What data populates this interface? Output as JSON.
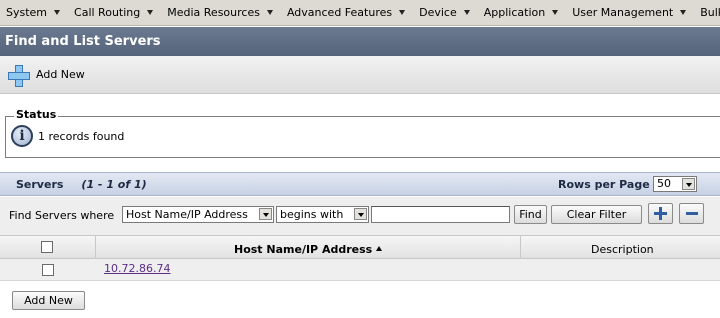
{
  "menu": {
    "items": [
      {
        "label": "System"
      },
      {
        "label": "Call Routing"
      },
      {
        "label": "Media Resources"
      },
      {
        "label": "Advanced Features"
      },
      {
        "label": "Device"
      },
      {
        "label": "Application"
      },
      {
        "label": "User Management"
      },
      {
        "label": "Bulk Administration"
      }
    ]
  },
  "page": {
    "title": "Find and List Servers"
  },
  "toolbar": {
    "add_new_label": "Add New",
    "add_icon": "add-plus-icon"
  },
  "status": {
    "legend": "Status",
    "icon": "info-icon",
    "icon_glyph": "i",
    "message": "1 records found"
  },
  "servers": {
    "title": "Servers",
    "count": "(1 - 1 of 1)",
    "rows_per_page_label": "Rows per Page",
    "rows_per_page_value": "50"
  },
  "filter": {
    "label": "Find Servers where",
    "field_value": "Host Name/IP Address",
    "operator_value": "begins with",
    "search_value": "",
    "find_label": "Find",
    "clear_label": "Clear Filter",
    "add_criteria_icon": "plus-icon",
    "remove_criteria_icon": "minus-icon"
  },
  "table": {
    "columns": [
      {
        "label": ""
      },
      {
        "label": "Host Name/IP Address",
        "sorted": "ascending"
      },
      {
        "label": "Description"
      }
    ],
    "rows": [
      {
        "host": "10.72.86.74",
        "description": ""
      }
    ]
  },
  "footer": {
    "add_new_label": "Add New"
  },
  "colors": {
    "title_bar": "#5d6b82",
    "section_header": "#d3dbeb",
    "link": "#5b2f86"
  }
}
